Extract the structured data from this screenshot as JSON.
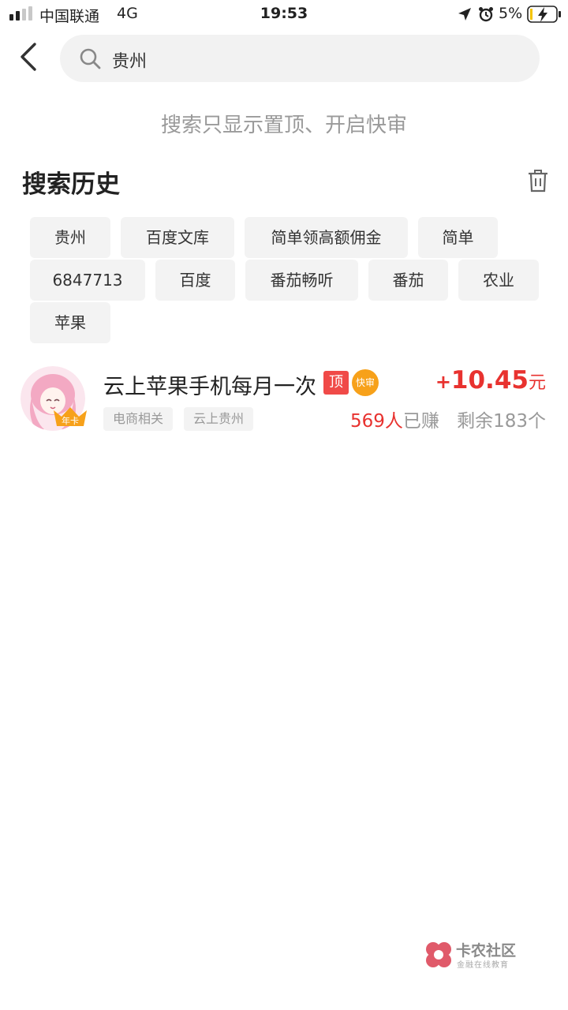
{
  "status_bar": {
    "carrier": "中国联通",
    "network": "4G",
    "time": "19:53",
    "battery": "5%"
  },
  "search": {
    "value": "贵州"
  },
  "hint": "搜索只显示置顶、开启快审",
  "history": {
    "title": "搜索历史",
    "tags": [
      "贵州",
      "百度文库",
      "简单领高额佣金",
      "简单",
      "6847713",
      "百度",
      "番茄畅听",
      "番茄",
      "农业",
      "苹果"
    ]
  },
  "results": [
    {
      "title": "云上苹果手机每月一次",
      "top_badge": "顶",
      "fast_badge": "快审",
      "avatar_badge": "年卡",
      "reward_plus": "+",
      "reward_amount": "10.45",
      "reward_unit": "元",
      "tags": [
        "电商相关",
        "云上贵州"
      ],
      "earned_count": "569人",
      "earned_suffix": "已赚",
      "remaining": "剩余183个"
    }
  ],
  "watermark": {
    "name": "卡农社区",
    "sub": "金融在线教育"
  },
  "colors": {
    "accent_red": "#e8322f",
    "badge_orange": "#f7a11a",
    "tag_bg": "#f3f3f3"
  }
}
